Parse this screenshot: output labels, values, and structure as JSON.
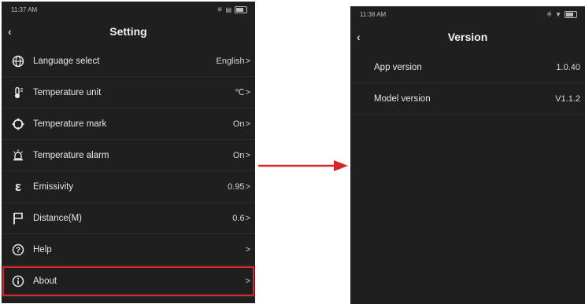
{
  "left_screen": {
    "status": {
      "time": "11:37 AM"
    },
    "title": "Setting",
    "back_icon": "chevron-left-icon",
    "items": [
      {
        "label": "Language select",
        "value": "English",
        "icon": "globe-icon"
      },
      {
        "label": "Temperature unit",
        "value": "℃",
        "icon": "thermometer-icon"
      },
      {
        "label": "Temperature mark",
        "value": "On",
        "icon": "crosshair-icon"
      },
      {
        "label": "Temperature alarm",
        "value": "On",
        "icon": "alarm-light-icon"
      },
      {
        "label": "Emissivity",
        "value": "0.95",
        "icon": "epsilon-icon"
      },
      {
        "label": "Distance(M)",
        "value": "0.6",
        "icon": "flag-icon"
      },
      {
        "label": "Help",
        "value": "",
        "icon": "help-icon"
      },
      {
        "label": "About",
        "value": "",
        "icon": "info-icon"
      }
    ],
    "chevron": ">"
  },
  "right_screen": {
    "status": {
      "time": "11:38 AM"
    },
    "title": "Version",
    "back_icon": "chevron-left-icon",
    "rows": [
      {
        "label": "App version",
        "value": "1.0.40"
      },
      {
        "label": "Model version",
        "value": "V1.1.2"
      }
    ]
  },
  "colors": {
    "phone_bg": "#1f1f1f",
    "highlight": "#d8262a",
    "arrow": "#d8262a"
  }
}
